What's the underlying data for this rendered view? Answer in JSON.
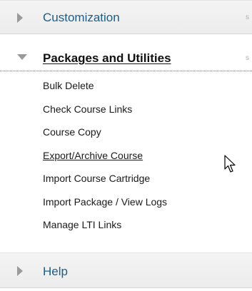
{
  "menu": {
    "sections": {
      "customization": {
        "label": "Customization",
        "expanded": false
      },
      "packages": {
        "label": "Packages and Utilities",
        "expanded": true
      },
      "help": {
        "label": "Help",
        "expanded": false
      }
    },
    "packages_items": [
      {
        "label": "Bulk Delete"
      },
      {
        "label": "Check Course Links"
      },
      {
        "label": "Course Copy"
      },
      {
        "label": "Export/Archive Course"
      },
      {
        "label": "Import Course Cartridge"
      },
      {
        "label": "Import Package / View Logs"
      },
      {
        "label": "Manage LTI Links"
      }
    ],
    "hovered_item": "Export/Archive Course"
  },
  "icons": {
    "collapsed_arrow": "triangle-right-icon",
    "expanded_arrow": "triangle-down-icon",
    "pointer": "mouse-pointer-icon"
  },
  "colors": {
    "link_blue": "#1d5d86",
    "arrow_gray": "#9a9a9a",
    "text_dark": "#111111",
    "collapsed_bg": "#f0f0f0"
  }
}
